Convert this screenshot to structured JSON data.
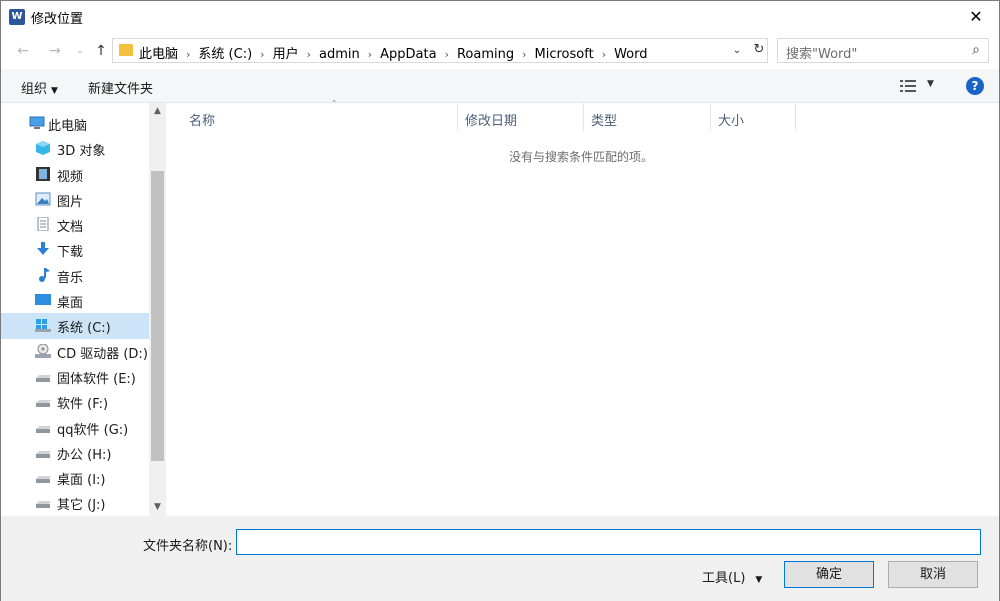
{
  "window": {
    "title": "修改位置",
    "app_icon_letter": "W",
    "close_glyph": "✕"
  },
  "nav": {
    "back_glyph": "←",
    "forward_glyph": "→",
    "dropdown_glyph": "⌄",
    "up_glyph": "↑"
  },
  "address": {
    "crumbs": [
      "此电脑",
      "系统 (C:)",
      "用户",
      "admin",
      "AppData",
      "Roaming",
      "Microsoft",
      "Word"
    ],
    "separator": "›",
    "dropdown_glyph": "⌄",
    "refresh_glyph": "↻"
  },
  "search": {
    "placeholder": "搜索\"Word\"",
    "icon_glyph": "⌕"
  },
  "toolbar": {
    "organize_label": "组织",
    "new_folder_label": "新建文件夹",
    "caret_glyph": "▼",
    "help_glyph": "?"
  },
  "sidebar": {
    "items": [
      {
        "label": "此电脑",
        "icon": "computer-icon",
        "indent": 0
      },
      {
        "label": "3D 对象",
        "icon": "cube-icon",
        "indent": 1
      },
      {
        "label": "视频",
        "icon": "video-icon",
        "indent": 1
      },
      {
        "label": "图片",
        "icon": "picture-icon",
        "indent": 1
      },
      {
        "label": "文档",
        "icon": "document-icon",
        "indent": 1
      },
      {
        "label": "下载",
        "icon": "download-icon",
        "indent": 1
      },
      {
        "label": "音乐",
        "icon": "music-icon",
        "indent": 1
      },
      {
        "label": "桌面",
        "icon": "desktop-icon",
        "indent": 1
      },
      {
        "label": "系统 (C:)",
        "icon": "windows-drive-icon",
        "indent": 1,
        "selected": true
      },
      {
        "label": "CD 驱动器 (D:)",
        "icon": "cd-drive-icon",
        "indent": 1
      },
      {
        "label": "固体软件 (E:)",
        "icon": "drive-icon",
        "indent": 1
      },
      {
        "label": "软件 (F:)",
        "icon": "drive-icon",
        "indent": 1
      },
      {
        "label": "qq软件 (G:)",
        "icon": "drive-icon",
        "indent": 1
      },
      {
        "label": "办公 (H:)",
        "icon": "drive-icon",
        "indent": 1
      },
      {
        "label": "桌面 (I:)",
        "icon": "drive-icon",
        "indent": 1
      },
      {
        "label": "其它 (J:)",
        "icon": "drive-icon",
        "indent": 1
      }
    ],
    "scroll_up_glyph": "▲",
    "scroll_down_glyph": "▼"
  },
  "list": {
    "columns": [
      "名称",
      "修改日期",
      "类型",
      "大小"
    ],
    "sort_glyph": "˄",
    "empty_message": "没有与搜索条件匹配的项。"
  },
  "footer": {
    "folder_name_label": "文件夹名称(N):",
    "folder_name_value": "",
    "tools_label": "工具(L)",
    "caret_glyph": "▼",
    "ok_label": "确定",
    "cancel_label": "取消"
  },
  "colors": {
    "selection": "#cce4f7",
    "accent": "#0078d7",
    "header_text": "#4c607a",
    "folder": "#f3c040",
    "help": "#1a64c8"
  }
}
